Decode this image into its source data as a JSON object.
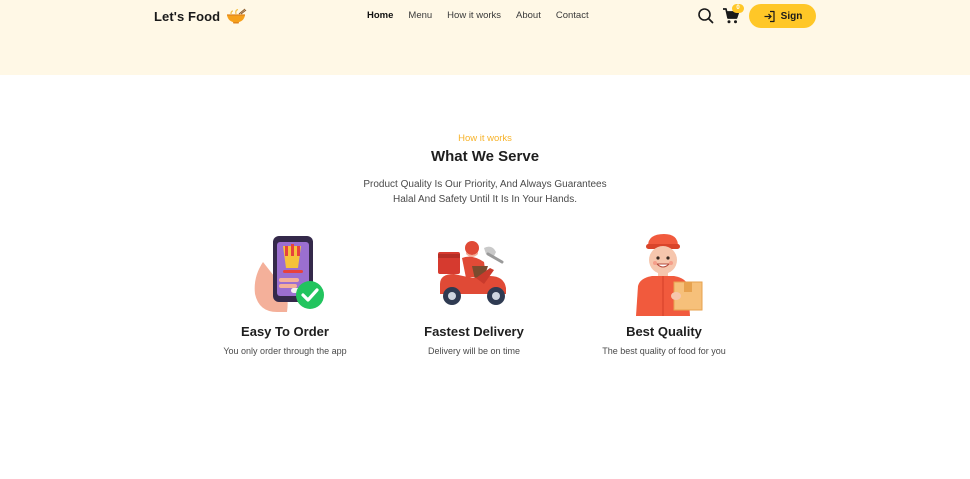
{
  "brand": {
    "name": "Let's Food",
    "logo_icon": "bowl-icon"
  },
  "nav": {
    "items": [
      {
        "label": "Home",
        "active": true
      },
      {
        "label": "Menu",
        "active": false
      },
      {
        "label": "How it works",
        "active": false
      },
      {
        "label": "About",
        "active": false
      },
      {
        "label": "Contact",
        "active": false
      }
    ]
  },
  "header_actions": {
    "search_icon": "search-icon",
    "cart_icon": "cart-icon",
    "cart_badge": "0",
    "sign_label": "Sign",
    "sign_icon": "sign-in-icon"
  },
  "section": {
    "eyebrow": "How it works",
    "title": "What We Serve",
    "description_line1": "Product Quality Is Our Priority, And Always Guarantees",
    "description_line2": "Halal And Safety Until It Is In Your Hands."
  },
  "features": [
    {
      "title": "Easy To Order",
      "description": "You only order through the app",
      "icon": "phone-order-icon"
    },
    {
      "title": "Fastest Delivery",
      "description": "Delivery will be on time",
      "icon": "delivery-scooter-icon"
    },
    {
      "title": "Best Quality",
      "description": "The best quality of food for you",
      "icon": "courier-box-icon"
    }
  ],
  "colors": {
    "accent": "#ffc727",
    "hero_bg": "#fff8e6",
    "eyebrow": "#f7b32b",
    "text": "#1e1e1e"
  }
}
